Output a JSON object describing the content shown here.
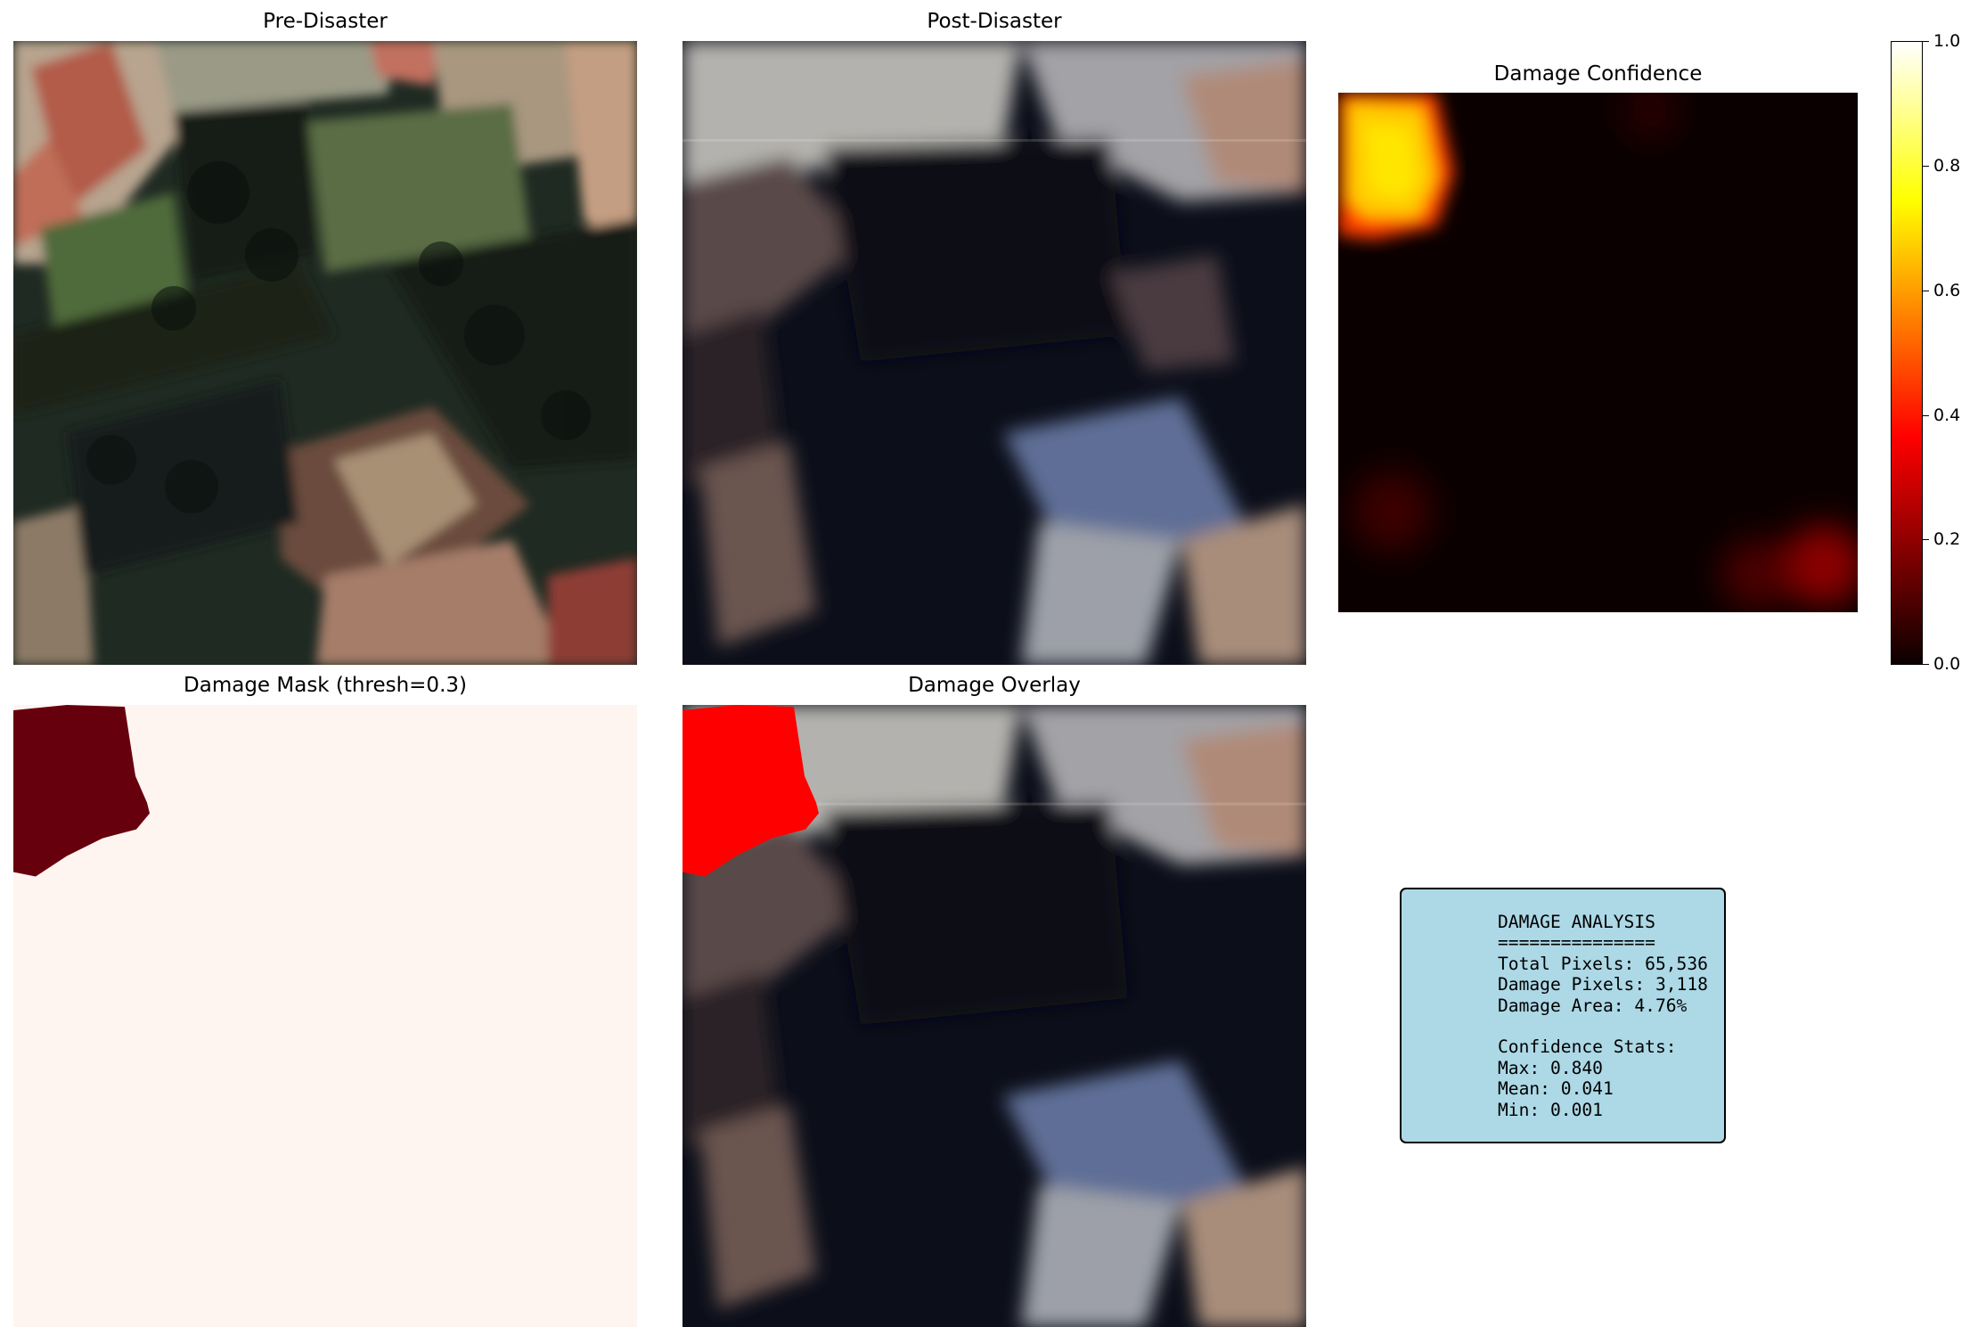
{
  "panels": {
    "pre": {
      "title": "Pre-Disaster"
    },
    "post": {
      "title": "Post-Disaster"
    },
    "confidence": {
      "title": "Damage Confidence"
    },
    "mask": {
      "title": "Damage Mask (thresh=0.3)"
    },
    "overlay": {
      "title": "Damage Overlay"
    }
  },
  "colorbar": {
    "colormap": "hot",
    "ticks": [
      "0.0",
      "0.2",
      "0.4",
      "0.6",
      "0.8",
      "1.0"
    ],
    "range": [
      0.0,
      1.0
    ]
  },
  "stats": {
    "lines": [
      "DAMAGE ANALYSIS",
      "===============",
      "Total Pixels: 65,536",
      "Damage Pixels: 3,118",
      "Damage Area: 4.76%",
      "",
      "Confidence Stats:",
      "Max: 0.840",
      "Mean: 0.041",
      "Min: 0.001"
    ],
    "box_color": "#add8e6"
  },
  "colors": {
    "mask_damage": "#67000d",
    "mask_background": "#fff5f0",
    "overlay_damage": "#ff0000"
  }
}
